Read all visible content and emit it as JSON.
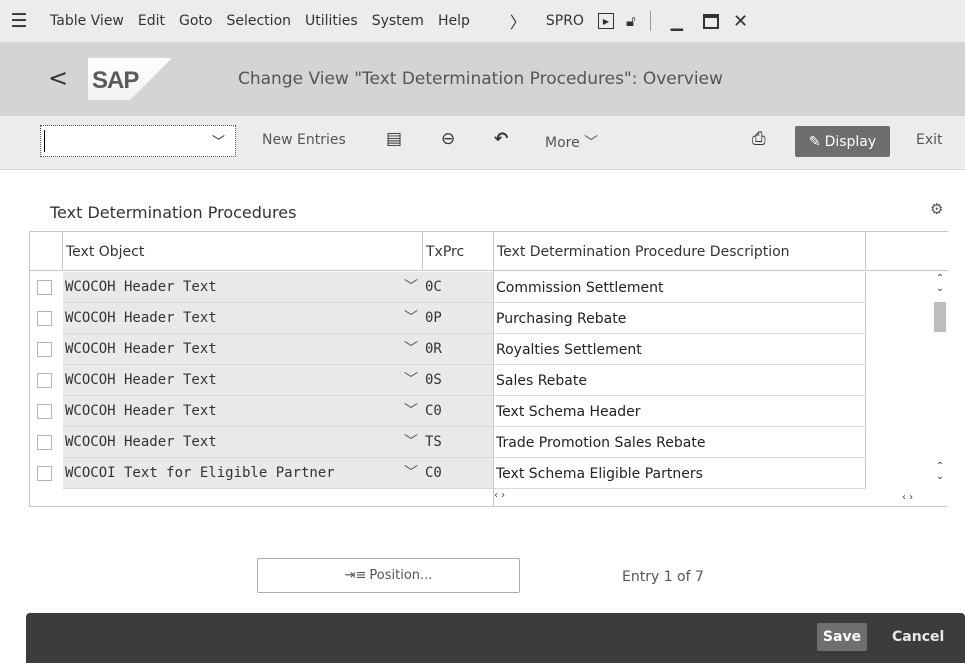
{
  "menubar": {
    "items": [
      "Table View",
      "Edit",
      "Goto",
      "Selection",
      "Utilities",
      "System",
      "Help"
    ],
    "transaction": "SPRO"
  },
  "titlebar": {
    "title": "Change View \"Text Determination Procedures\": Overview",
    "logo_text": "SAP"
  },
  "toolbar": {
    "command_value": "",
    "new_entries": "New Entries",
    "more": "More",
    "display": "Display",
    "exit": "Exit"
  },
  "section": {
    "title": "Text Determination Procedures"
  },
  "table": {
    "headers": {
      "object": "Text Object",
      "code": "TxPrc",
      "desc": "Text Determination Procedure Description"
    },
    "rows": [
      {
        "object": "WCOCOH Header Text",
        "code": "0C",
        "desc": "Commission Settlement"
      },
      {
        "object": "WCOCOH Header Text",
        "code": "0P",
        "desc": "Purchasing Rebate"
      },
      {
        "object": "WCOCOH Header Text",
        "code": "0R",
        "desc": "Royalties Settlement"
      },
      {
        "object": "WCOCOH Header Text",
        "code": "0S",
        "desc": "Sales Rebate"
      },
      {
        "object": "WCOCOH Header Text",
        "code": "C0",
        "desc": "Text Schema Header"
      },
      {
        "object": "WCOCOH Header Text",
        "code": "TS",
        "desc": "Trade Promotion Sales Rebate"
      },
      {
        "object": "WCOCOI Text for Eligible Partner",
        "code": "C0",
        "desc": "Text Schema Eligible Partners"
      }
    ]
  },
  "footer": {
    "position": "Position...",
    "entry": "Entry 1 of 7"
  },
  "bottombar": {
    "save": "Save",
    "cancel": "Cancel"
  },
  "colors": {
    "menubar_bg": "#ececec",
    "titlebar_bg": "#d4d4d4",
    "bottombar_bg": "#3c3c3c",
    "display_bg": "#6e6e6e",
    "input_cell_bg": "#e9e9e9"
  }
}
